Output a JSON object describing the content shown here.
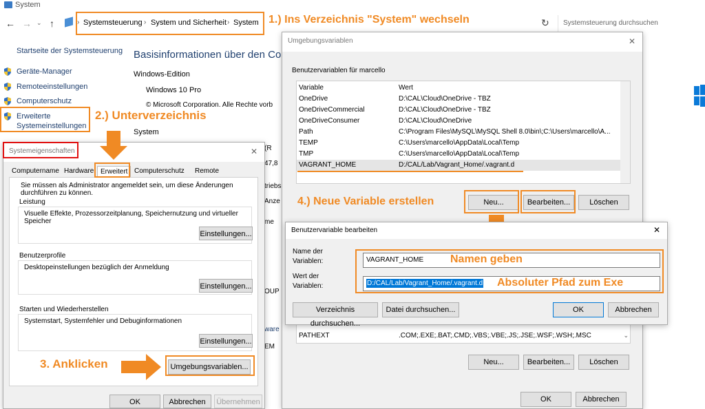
{
  "window": {
    "title": "System"
  },
  "addressbar": {
    "crumbs": [
      "Systemsteuerung",
      "System und Sicherheit",
      "System"
    ],
    "search_placeholder": "Systemsteuerung durchsuchen"
  },
  "sidebar": {
    "home": "Startseite der Systemsteuerung",
    "items": [
      "Geräte-Manager",
      "Remoteeinstellungen",
      "Computerschutz",
      "Erweiterte Systemeinstellungen"
    ]
  },
  "main": {
    "heading": "Basisinformationen über den Comp",
    "edition_label": "Windows-Edition",
    "edition": "Windows 10 Pro",
    "copyright": "© Microsoft Corporation. Alle Rechte vorb",
    "system_label": "System",
    "partial": [
      "(R",
      "47,8",
      "triebs",
      "Anze",
      "me",
      "OUP",
      "ware",
      "EM"
    ]
  },
  "annotations": {
    "step1": "1.)  Ins Verzeichnis \"System\" wechseln",
    "step2": "2.) Unterverzeichnis",
    "step3": "3. Anklicken",
    "step4": "4.) Neue Variable erstellen",
    "names": "Namen geben",
    "path": "Absoluter Pfad zum Exe"
  },
  "sysprops": {
    "title": "Systemeigenschaften",
    "tabs": [
      "Computername",
      "Hardware",
      "Erweitert",
      "Computerschutz",
      "Remote"
    ],
    "admin_note": "Sie müssen als Administrator angemeldet sein, um diese Änderungen durchführen zu können.",
    "perf_label": "Leistung",
    "perf_desc": "Visuelle Effekte, Prozessorzeitplanung, Speichernutzung und virtueller Speicher",
    "profile_label": "Benutzerprofile",
    "profile_desc": "Desktopeinstellungen bezüglich der Anmeldung",
    "startup_label": "Starten und Wiederherstellen",
    "startup_desc": "Systemstart, Systemfehler und Debuginformationen",
    "settings_btn": "Einstellungen...",
    "env_btn": "Umgebungsvariablen...",
    "ok": "OK",
    "cancel": "Abbrechen",
    "apply": "Übernehmen"
  },
  "envvars": {
    "title": "Umgebungsvariablen",
    "user_label": "Benutzervariablen für marcello",
    "col_var": "Variable",
    "col_val": "Wert",
    "rows": [
      {
        "name": "OneDrive",
        "value": "D:\\CAL\\Cloud\\OneDrive - TBZ"
      },
      {
        "name": "OneDriveCommercial",
        "value": "D:\\CAL\\Cloud\\OneDrive - TBZ"
      },
      {
        "name": "OneDriveConsumer",
        "value": "D:\\CAL\\Cloud\\OneDrive"
      },
      {
        "name": "Path",
        "value": "C:\\Program Files\\MySQL\\MySQL Shell 8.0\\bin\\;C:\\Users\\marcello\\A..."
      },
      {
        "name": "TEMP",
        "value": "C:\\Users\\marcello\\AppData\\Local\\Temp"
      },
      {
        "name": "TMP",
        "value": "C:\\Users\\marcello\\AppData\\Local\\Temp"
      },
      {
        "name": "VAGRANT_HOME",
        "value": "D:/CAL/Lab/Vagrant_Home/.vagrant.d"
      }
    ],
    "sys_row": {
      "name": "PATHEXT",
      "value": ".COM;.EXE;.BAT;.CMD;.VBS;.VBE;.JS;.JSE;.WSF;.WSH;.MSC"
    },
    "new_btn": "Neu...",
    "edit_btn": "Bearbeiten...",
    "delete_btn": "Löschen",
    "ok": "OK",
    "cancel": "Abbrechen"
  },
  "editvar": {
    "title": "Benutzervariable bearbeiten",
    "name_label": "Name der Variablen:",
    "name_value": "VAGRANT_HOME",
    "value_label": "Wert der Variablen:",
    "value_value": "D:/CAL/Lab/Vagrant_Home/.vagrant.d",
    "browse_dir": "Verzeichnis durchsuchen...",
    "browse_file": "Datei durchsuchen...",
    "ok": "OK",
    "cancel": "Abbrechen"
  },
  "colors": {
    "accent": "#f08a24",
    "link": "#1f3f6e",
    "select": "#0078d7"
  }
}
